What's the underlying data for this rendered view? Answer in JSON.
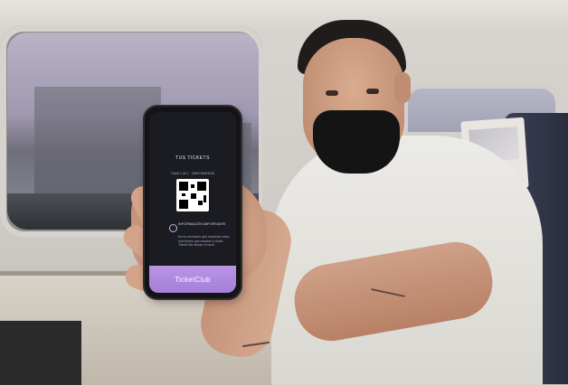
{
  "photo": {
    "subject": "person",
    "objects": [
      "window",
      "seat",
      "table",
      "phone"
    ]
  },
  "phone_screen": {
    "tickets_title": "TUS TICKETS",
    "ticket_line": "Ticket 1 de 1 · 4084760823345",
    "info_title": "INFORMACIÓN IMPORTANTE",
    "info_text": "No es necesario que imprimas nada, solo tienes que mostrar tu ticket TicketClub desde el móvil.",
    "brand": "TicketClub",
    "accent_color": "#a57fd8"
  }
}
